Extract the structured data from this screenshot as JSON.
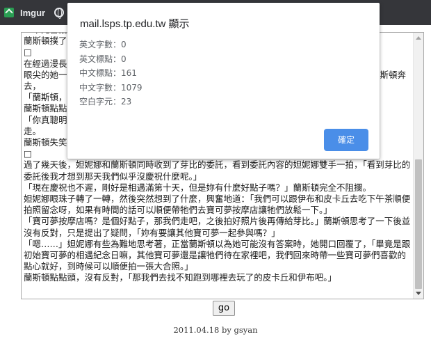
{
  "bookmarks": {
    "items": [
      {
        "label": "Imgur",
        "icon": "imgur-icon"
      },
      {
        "label": "",
        "icon": "globe-icon"
      }
    ]
  },
  "editor": {
    "text": "「中元普渡｜要準備些甚麼才好呢？」妲妮娜手指著寶可夢圖鑑問著，而蘭斯頓則在一旁不\n蘭斯頓撲了\n□\n在經過漫長的旅程後，他們終於找到了那間寶可夢中心，而妲妮娜一眼就認出了那隻伊布時，\n眼尖的她一看便知道那是自己的伊布，立刻就衝了過去，蘭斯頓見狀也趕緊跟著追了過去，蘭斯頓奔去，\n「蘭斯頓，\n蘭斯頓點點\n「你真聰明，居然想到要找皮卡丘，這樣牠們就可以一起玩了。」說完，妲妮娜抱起皮卡丘抱\n走。\n蘭斯頓失笑\n□\n過了幾天後，妲妮娜和蘭斯頓同時收到了芽比的委託，看到委託內容的妲妮娜雙手一拍，「看到芽比的委託後我才想到那天我們似乎沒慶祝什麼呢。」\n「現在慶祝也不遲，剛好是相遇滿第十天，但是妳有什麼好點子嗎？」蘭斯頓完全不阻攔。\n妲妮娜眼珠子轉了一轉，然後突然想到了什麼，興奮地道：「我們可以跟伊布和皮卡丘去吃下午茶順便拍照留念呀，如果有時間的話可以順便帶牠們去寶可夢按摩店讓牠們放鬆一下。」\n「寶可夢按摩店嗎？是個好點子，那我們走吧，之後拍好照片後再傳給芽比。」蘭斯頓思考了一下後並沒有反對，只是提出了疑問，「妳有要讓其他寶可夢一起參與嗎？」\n「嗯……」妲妮娜有些為難地思考著，正當蘭斯頓以為她可能沒有答案時，她開口回覆了，「畢竟是跟初始寶可夢的相遇紀念日嘛，其他寶可夢還是讓牠們待在家裡吧，我們回來時帶一些寶可夢們喜歡的點心就好，到時候可以順便拍一張大合照。」\n蘭斯頓點點頭，沒有反對，「那我們去找不知跑到哪裡去玩了的皮卡丘和伊布吧。」",
    "go_label": "go"
  },
  "footer": {
    "text": "2011.04.18 by gsyan"
  },
  "dialog": {
    "title": "mail.lsps.tp.edu.tw 顯示",
    "lines": [
      "英文字數：0",
      "英文標點：0",
      "中文標點：161",
      "中文字數：1079",
      "空白字元：23"
    ],
    "ok_label": "確定"
  },
  "colors": {
    "dialog_button": "#4a8ee8",
    "bookmarks_bar": "#35363a"
  }
}
